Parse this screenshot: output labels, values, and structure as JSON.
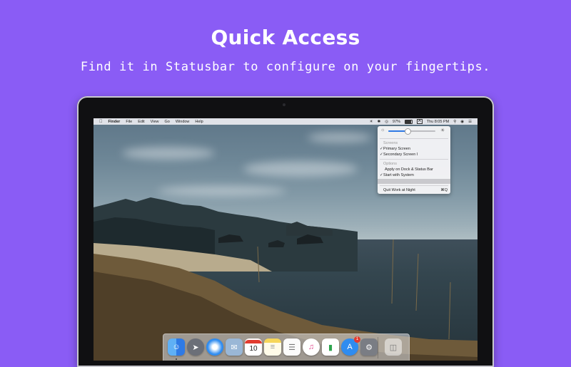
{
  "promo": {
    "title": "Quick Access",
    "subtitle": "Find it in Statusbar to configure on your fingertips."
  },
  "menubar": {
    "apple_icon": "apple-icon",
    "app_name": "Finder",
    "menus": [
      "File",
      "Edit",
      "View",
      "Go",
      "Window",
      "Help"
    ],
    "battery": "97%",
    "input_source": "A",
    "clock": "Thu 8:05 PM"
  },
  "status_menu": {
    "brightness": 0.4,
    "screens_header": "Screens",
    "screens": [
      {
        "label": "Primary Screen",
        "checked": true
      },
      {
        "label": "Secondary Screen I",
        "checked": true
      }
    ],
    "options_header": "Options",
    "options": [
      {
        "label": "Apply on Dock & Status Bar",
        "checked": false
      },
      {
        "label": "Start with System",
        "checked": true
      }
    ],
    "quit_label": "Quit Work at Night",
    "quit_shortcut": "⌘Q",
    "highlight_color": "#c9c9cd"
  },
  "dock": {
    "calendar_day": "10",
    "appstore_badge": "1",
    "items": [
      "finder-icon",
      "launchpad-icon",
      "safari-icon",
      "mail-icon",
      "calendar-icon",
      "notes-icon",
      "reminders-icon",
      "music-icon",
      "numbers-icon",
      "app-store-icon",
      "system-preferences-icon",
      "trash-icon"
    ]
  },
  "colors": {
    "background": "#8a5cf5",
    "accent": "#2f7ae5"
  }
}
